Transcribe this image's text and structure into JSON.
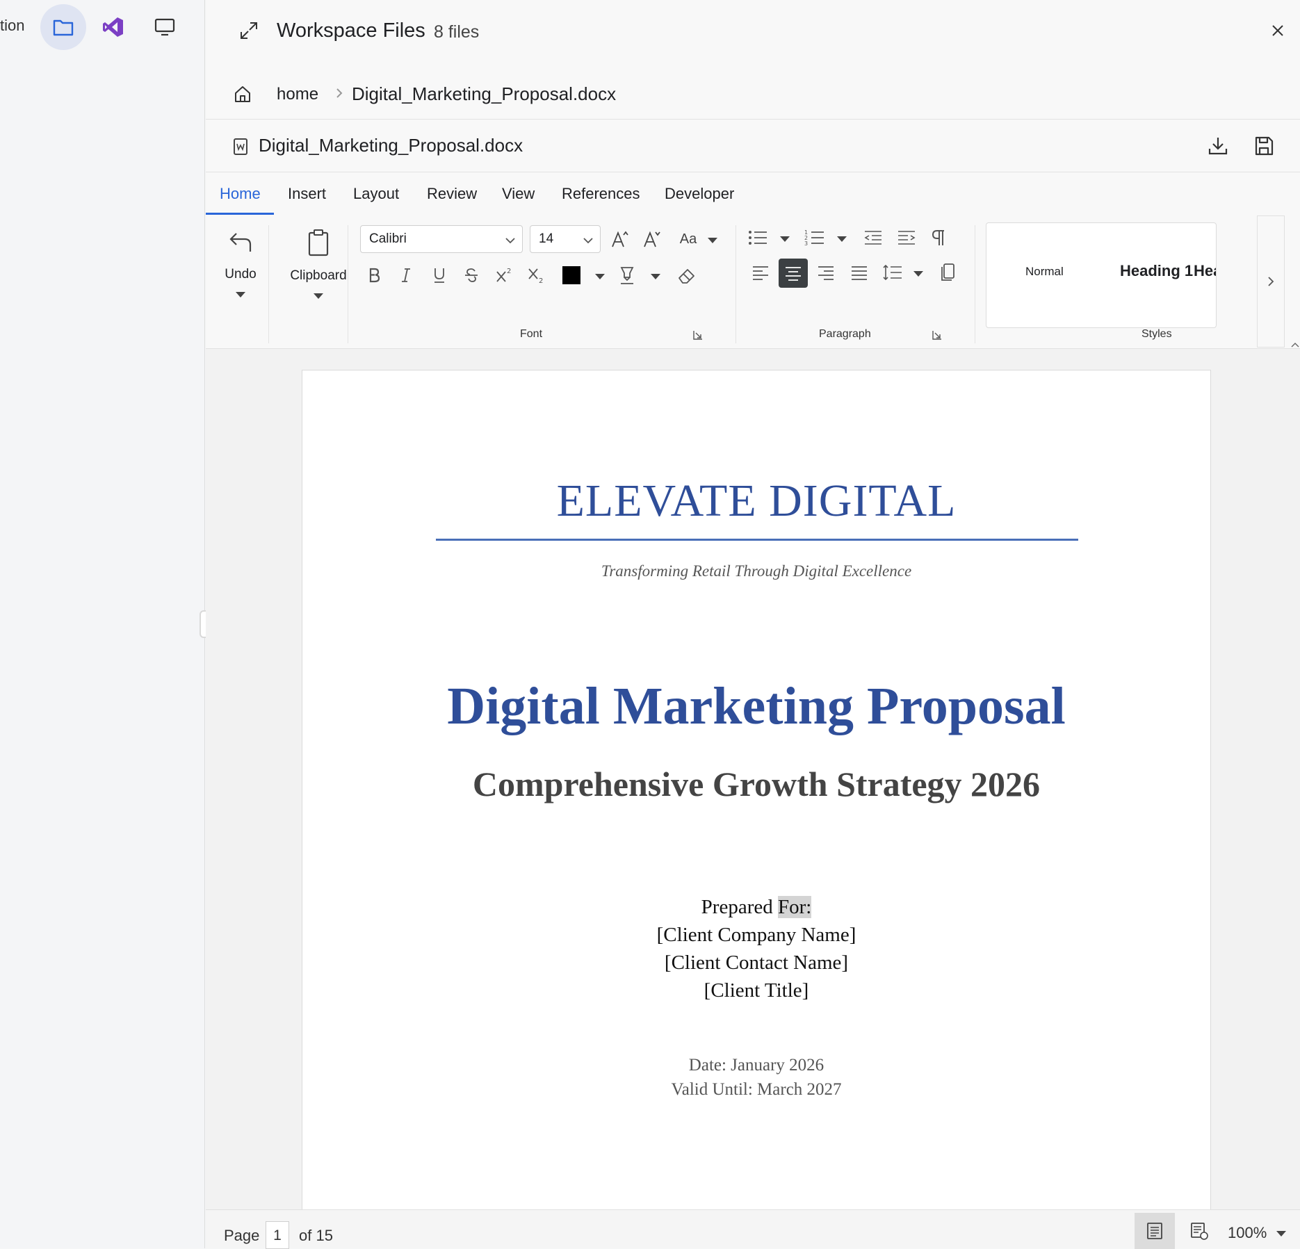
{
  "rail": {
    "partial_label": "tion",
    "icons": [
      "folder-icon",
      "visual-studio-icon",
      "monitor-icon"
    ]
  },
  "panel": {
    "title": "Workspace Files",
    "file_count": "8 files"
  },
  "breadcrumb": {
    "home": "home",
    "file": "Digital_Marketing_Proposal.docx"
  },
  "file_bar": {
    "name": "Digital_Marketing_Proposal.docx"
  },
  "ribbon": {
    "tabs": [
      "Home",
      "Insert",
      "Layout",
      "Review",
      "View",
      "References",
      "Developer"
    ],
    "active_tab": "Home",
    "undo_label": "Undo",
    "clipboard_label": "Clipboard",
    "font_name": "Calibri",
    "font_size": "14",
    "case_label": "Aa",
    "font_group_label": "Font",
    "paragraph_group_label": "Paragraph",
    "styles_group_label": "Styles",
    "styles": [
      "Normal",
      "Heading 1",
      "Hea"
    ],
    "font_color": "#000000",
    "accent_color": "#2a66d9"
  },
  "document": {
    "company": "ELEVATE DIGITAL",
    "tagline": "Transforming Retail Through Digital Excellence",
    "title": "Digital Marketing Proposal",
    "subtitle": "Comprehensive Growth Strategy 2026",
    "prepared_label": "Prepared",
    "prepared_selected": "For:",
    "client_company": "[Client Company Name]",
    "client_contact": "[Client Contact Name]",
    "client_title": "[Client Title]",
    "date": "Date: January 2026",
    "valid_until": "Valid Until: March 2027",
    "title_color": "#2f4e99"
  },
  "status": {
    "page_label": "Page",
    "current_page": "1",
    "of_pages": "of 15",
    "zoom": "100%"
  }
}
